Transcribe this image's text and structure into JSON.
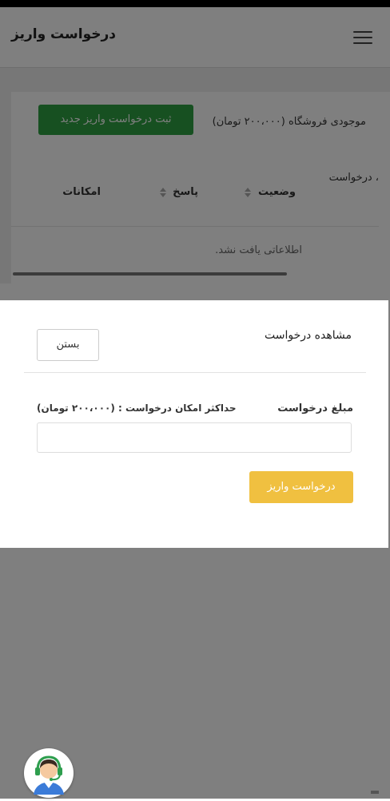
{
  "header": {
    "title": "درخواست واریز"
  },
  "main": {
    "new_request_button": "ثبت درخواست واریز جدید",
    "store_balance": "موجودی فروشگاه (۲۰۰،۰۰۰ تومان)",
    "section_label": "، درخواست",
    "table": {
      "columns": [
        "وضعیت",
        "پاسخ",
        "امکانات"
      ],
      "empty_message": "اطلاعاتی یافت نشد."
    }
  },
  "modal": {
    "title": "مشاهده درخواست",
    "close_label": "بستن",
    "amount_label": "مبلغ درخواست",
    "max_label": "حداکثر امکان درخواست : (۲۰۰،۰۰۰ تومان)",
    "amount_value": "",
    "submit_label": "درخواست واریز"
  },
  "colors": {
    "primary_button": "#2ea043",
    "submit_button": "#f0c040"
  },
  "icons": {
    "menu": "hamburger-icon",
    "sort": "sort-icon",
    "support": "headset-support-icon"
  }
}
